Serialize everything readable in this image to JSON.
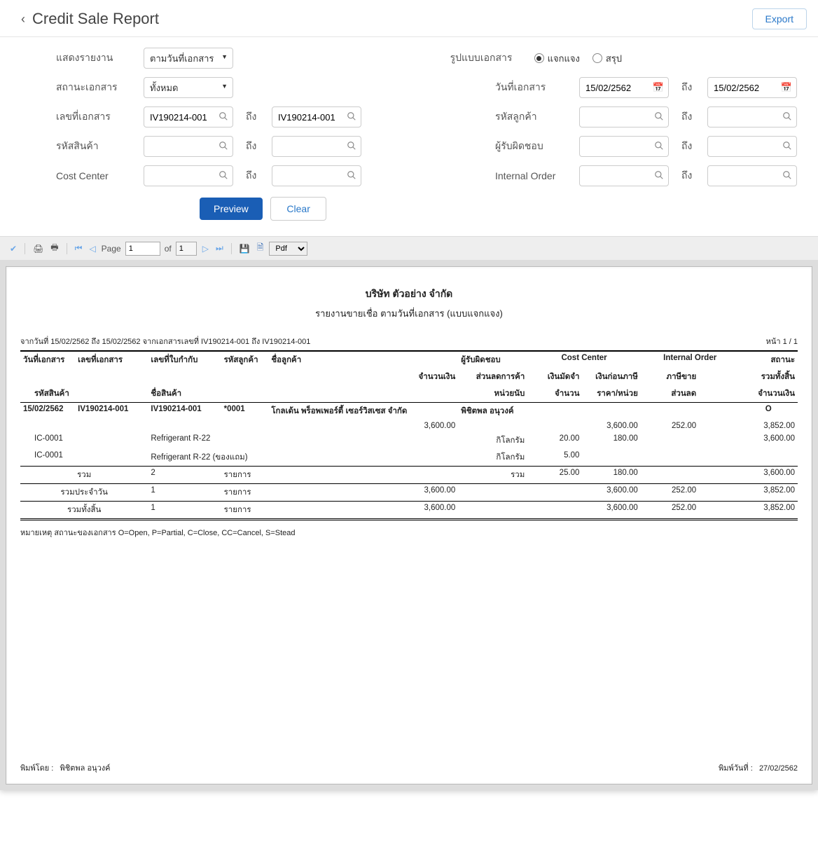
{
  "header": {
    "title": "Credit Sale Report",
    "export": "Export"
  },
  "filters": {
    "show_report": {
      "label": "แสดงรายงาน",
      "value": "ตามวันที่เอกสาร"
    },
    "doc_status": {
      "label": "สถานะเอกสาร",
      "value": "ทั้งหมด"
    },
    "doc_no": {
      "label": "เลขที่เอกสาร",
      "from": "IV190214-001",
      "to_label": "ถึง",
      "to": "IV190214-001"
    },
    "item_code": {
      "label": "รหัสสินค้า",
      "from": "",
      "to_label": "ถึง",
      "to": ""
    },
    "cost_center": {
      "label": "Cost Center",
      "from": "",
      "to_label": "ถึง",
      "to": ""
    },
    "doc_format": {
      "label": "รูปแบบเอกสาร",
      "opt1": "แจกแจง",
      "opt2": "สรุป"
    },
    "doc_date": {
      "label": "วันที่เอกสาร",
      "from": "15/02/2562",
      "to_label": "ถึง",
      "to": "15/02/2562"
    },
    "cust_code": {
      "label": "รหัสลูกค้า",
      "from": "",
      "to_label": "ถึง",
      "to": ""
    },
    "responsible": {
      "label": "ผู้รับผิดชอบ",
      "from": "",
      "to_label": "ถึง",
      "to": ""
    },
    "internal_order": {
      "label": "Internal Order",
      "from": "",
      "to_label": "ถึง",
      "to": ""
    }
  },
  "buttons": {
    "preview": "Preview",
    "clear": "Clear"
  },
  "toolbar": {
    "page_label": "Page",
    "page": "1",
    "of": "of",
    "total": "1",
    "format": "Pdf"
  },
  "report": {
    "company": "บริษัท ตัวอย่าง จำกัด",
    "title": "รายงานขายเชื่อ ตามวันที่เอกสาร (แบบแจกแจง)",
    "range_text": "จากวันที่ 15/02/2562 ถึง 15/02/2562 จากเอกสารเลขที่ IV190214-001 ถึง IV190214-001",
    "page_text": "หน้า 1 / 1",
    "cols": {
      "c1": "วันที่เอกสาร",
      "c2": "เลขที่เอกสาร",
      "c3": "เลขที่ใบกำกับ",
      "c4": "รหัสลูกค้า",
      "c5": "ชื่อลูกค้า",
      "c6": "ผู้รับผิดชอบ",
      "c7": "Cost Center",
      "c8": "Internal Order",
      "c9": "สถานะ",
      "r2c1": "จำนวนเงิน",
      "r2c2": "ส่วนลดการค้า",
      "r2c3": "เงินมัดจำ",
      "r2c4": "เงินก่อนภาษี",
      "r2c5": "ภาษีขาย",
      "r2c6": "รวมทั้งสิ้น",
      "r3c1": "รหัสสินค้า",
      "r3c2": "ชื่อสินค้า",
      "r3c3": "หน่วยนับ",
      "r3c4": "จำนวน",
      "r3c5": "ราคา/หน่วย",
      "r3c6": "ส่วนลด",
      "r3c7": "จำนวนเงิน"
    },
    "rows": {
      "hdr": {
        "date": "15/02/2562",
        "docno": "IV190214-001",
        "tax": "IV190214-001",
        "cust": "*0001",
        "custname": "โกลเด้น พร็อพเพอร์ตี้ เซอร์วิสเซส จำกัด",
        "resp": "พิชิตพล อนุวงค์",
        "status": "O"
      },
      "amt": {
        "amount": "3,600.00",
        "before_tax": "3,600.00",
        "vat": "252.00",
        "total": "3,852.00"
      },
      "items": [
        {
          "code": "IC-0001",
          "name": "Refrigerant R-22",
          "unit": "กิโลกรัม",
          "qty": "20.00",
          "price": "180.00",
          "amount": "3,600.00"
        },
        {
          "code": "IC-0001",
          "name": "Refrigerant R-22 (ของแถม)",
          "unit": "กิโลกรัม",
          "qty": "5.00",
          "price": "",
          "amount": ""
        }
      ],
      "subtotal": {
        "label": "รวม",
        "count": "2",
        "unit_label": "รายการ",
        "sum_label": "รวม",
        "qty": "25.00",
        "price": "180.00",
        "amount": "3,600.00"
      },
      "dayttl": {
        "label": "รวมประจำวัน",
        "count": "1",
        "unit_label": "รายการ",
        "amount": "3,600.00",
        "before_tax": "3,600.00",
        "vat": "252.00",
        "total": "3,852.00"
      },
      "grand": {
        "label": "รวมทั้งสิ้น",
        "count": "1",
        "unit_label": "รายการ",
        "amount": "3,600.00",
        "before_tax": "3,600.00",
        "vat": "252.00",
        "total": "3,852.00"
      }
    },
    "note": "หมายเหตุ สถานะของเอกสาร O=Open, P=Partial, C=Close, CC=Cancel, S=Stead",
    "footer": {
      "printed_by_label": "พิมพ์โดย :",
      "printed_by": "พิชิตพล อนุวงค์",
      "printed_date_label": "พิมพ์วันที่ :",
      "printed_date": "27/02/2562"
    }
  }
}
